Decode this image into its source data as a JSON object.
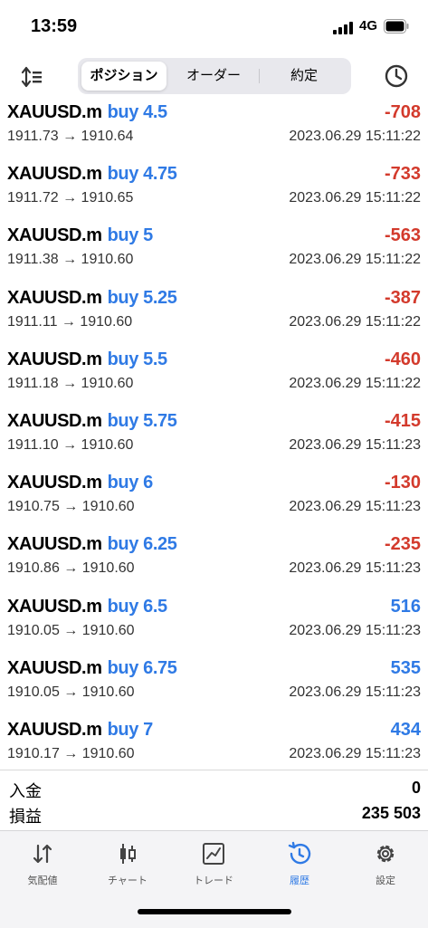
{
  "status_bar": {
    "time": "13:59",
    "network": "4G"
  },
  "segments": [
    {
      "label": "ポジション",
      "active": true
    },
    {
      "label": "オーダー",
      "active": false
    },
    {
      "label": "約定",
      "active": false
    }
  ],
  "trades": [
    {
      "symbol": "XAUUSD.m",
      "side": "buy 4.5",
      "profit": "-708",
      "prices": "1911.73 → 1910.64",
      "date": "2023.06.29 15:11:22"
    },
    {
      "symbol": "XAUUSD.m",
      "side": "buy 4.75",
      "profit": "-733",
      "prices": "1911.72 → 1910.65",
      "date": "2023.06.29 15:11:22"
    },
    {
      "symbol": "XAUUSD.m",
      "side": "buy 5",
      "profit": "-563",
      "prices": "1911.38 → 1910.60",
      "date": "2023.06.29 15:11:22"
    },
    {
      "symbol": "XAUUSD.m",
      "side": "buy 5.25",
      "profit": "-387",
      "prices": "1911.11 → 1910.60",
      "date": "2023.06.29 15:11:22"
    },
    {
      "symbol": "XAUUSD.m",
      "side": "buy 5.5",
      "profit": "-460",
      "prices": "1911.18 → 1910.60",
      "date": "2023.06.29 15:11:22"
    },
    {
      "symbol": "XAUUSD.m",
      "side": "buy 5.75",
      "profit": "-415",
      "prices": "1911.10 → 1910.60",
      "date": "2023.06.29 15:11:23"
    },
    {
      "symbol": "XAUUSD.m",
      "side": "buy 6",
      "profit": "-130",
      "prices": "1910.75 → 1910.60",
      "date": "2023.06.29 15:11:23"
    },
    {
      "symbol": "XAUUSD.m",
      "side": "buy 6.25",
      "profit": "-235",
      "prices": "1910.86 → 1910.60",
      "date": "2023.06.29 15:11:23"
    },
    {
      "symbol": "XAUUSD.m",
      "side": "buy 6.5",
      "profit": "516",
      "prices": "1910.05 → 1910.60",
      "date": "2023.06.29 15:11:23"
    },
    {
      "symbol": "XAUUSD.m",
      "side": "buy 6.75",
      "profit": "535",
      "prices": "1910.05 → 1910.60",
      "date": "2023.06.29 15:11:23"
    },
    {
      "symbol": "XAUUSD.m",
      "side": "buy 7",
      "profit": "434",
      "prices": "1910.17 → 1910.60",
      "date": "2023.06.29 15:11:23"
    }
  ],
  "summary": {
    "deposit_label": "入金",
    "deposit_value": "0",
    "pnl_label": "損益",
    "pnl_value": "235 503"
  },
  "tabbar": [
    {
      "icon": "quotes-icon",
      "label": "気配値",
      "active": false
    },
    {
      "icon": "chart-icon",
      "label": "チャート",
      "active": false
    },
    {
      "icon": "trade-icon",
      "label": "トレード",
      "active": false
    },
    {
      "icon": "history-icon",
      "label": "履歴",
      "active": true
    },
    {
      "icon": "settings-icon",
      "label": "設定",
      "active": false
    }
  ],
  "colors": {
    "accent": "#2f7ae5",
    "loss": "#d33a2c"
  }
}
